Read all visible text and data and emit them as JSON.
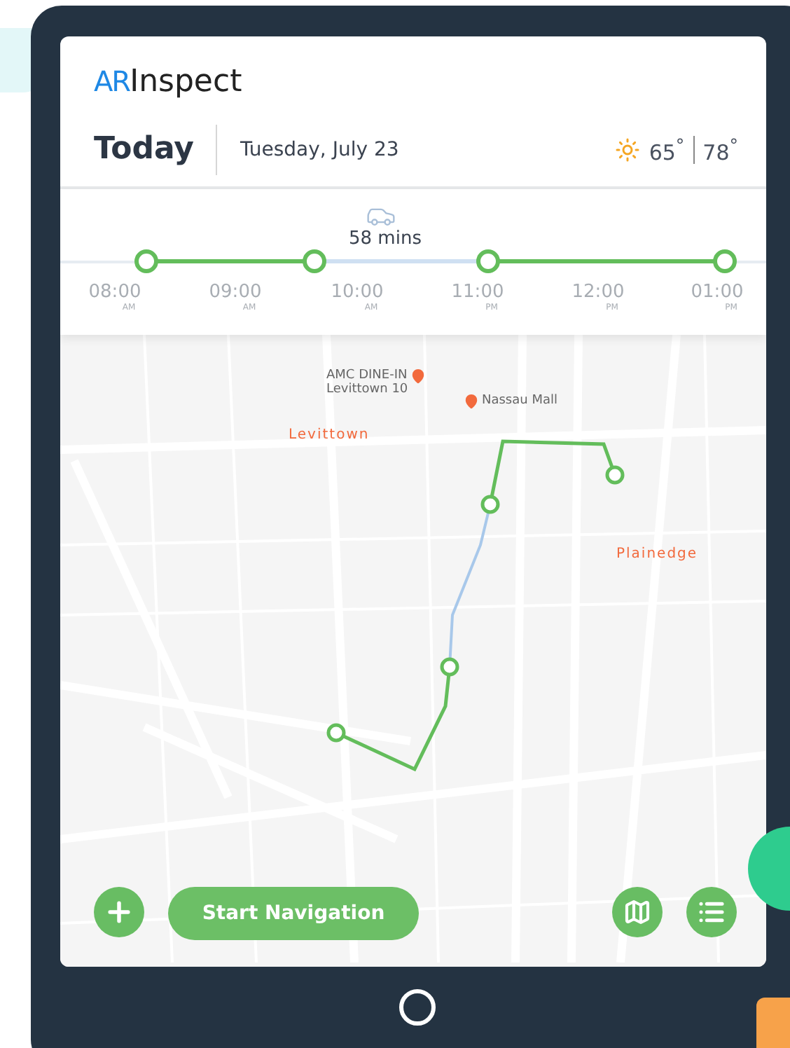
{
  "app": {
    "logo_mark": "AR",
    "logo_text": "Inspect"
  },
  "header": {
    "title": "Today",
    "date": "Tuesday, July 23",
    "weather": {
      "low": "65$^{°}$",
      "high": "78$^{°}$"
    }
  },
  "timeline": {
    "duration": "58 mins",
    "segments": [
      {
        "kind": "visit"
      },
      {
        "kind": "drive"
      },
      {
        "kind": "visit"
      }
    ],
    "times": [
      {
        "time": "08:00",
        "period": "AM"
      },
      {
        "time": "09:00",
        "period": "AM"
      },
      {
        "time": "10:00",
        "period": "AM"
      },
      {
        "time": "11:00",
        "period": "PM"
      },
      {
        "time": "12:00",
        "period": "PM"
      },
      {
        "time": "01:00",
        "period": "PM"
      }
    ]
  },
  "map": {
    "places": [
      {
        "kind": "place",
        "label": "Levittown"
      },
      {
        "kind": "place",
        "label": "Plainedge"
      },
      {
        "kind": "poi",
        "label": "AMC DINE-IN\nLevittown 10"
      },
      {
        "kind": "poi",
        "label": "Nassau Mall"
      }
    ]
  },
  "actions": {
    "primary": "Start Navigation"
  }
}
